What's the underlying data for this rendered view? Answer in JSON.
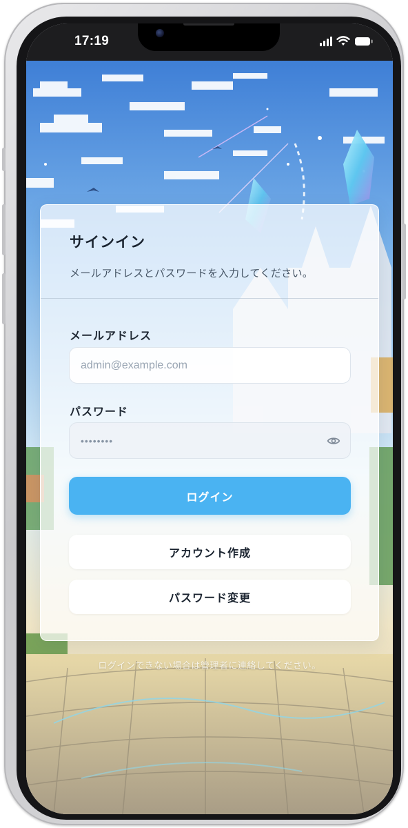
{
  "status_bar": {
    "time": "17:19"
  },
  "signin": {
    "title": "サインイン",
    "description": "メールアドレスとパスワードを入力してください。",
    "email": {
      "label": "メールアドレス",
      "placeholder": "admin@example.com",
      "value": ""
    },
    "password": {
      "label": "パスワード",
      "masked_value": "••••••••"
    },
    "login_button": "ログイン",
    "create_account_button": "アカウント作成",
    "change_password_button": "パスワード変更",
    "footer_note": "ログインできない場合は管理者に連絡してください。"
  },
  "colors": {
    "primary": "#4ab3f2",
    "title_text": "#1b2430",
    "muted_text": "#465565",
    "placeholder_text": "#98a4b2"
  },
  "icons": {
    "password_toggle": "eye-icon",
    "signal": "cellular-signal-icon",
    "wifi": "wifi-icon",
    "battery": "battery-icon"
  }
}
